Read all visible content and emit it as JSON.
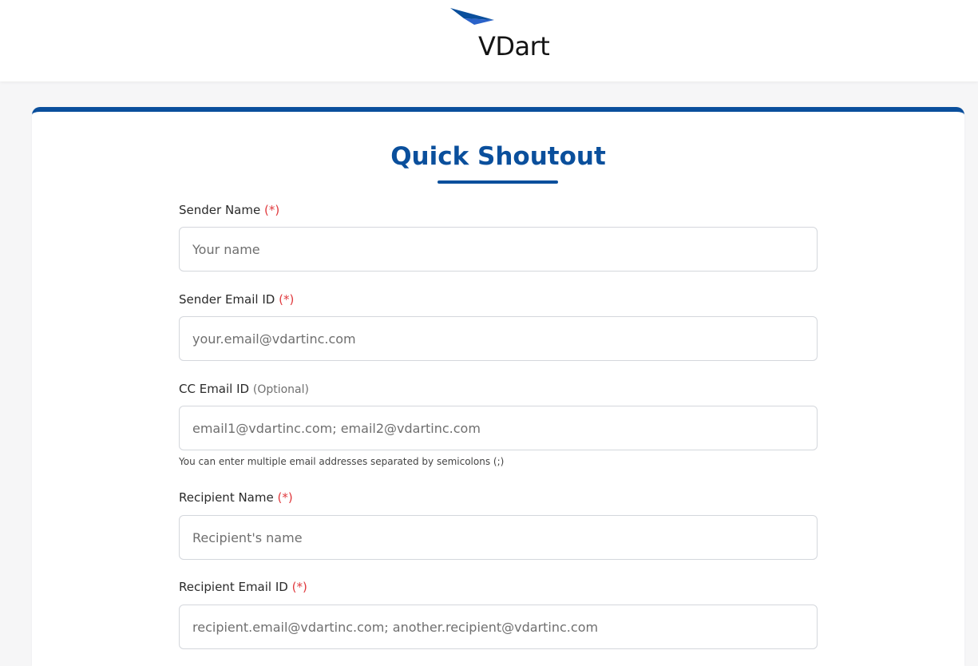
{
  "header": {
    "logo_text": "VDart",
    "brand_color": "#0a4f9c"
  },
  "form": {
    "title": "Quick Shoutout",
    "required_marker": "(*)",
    "fields": {
      "sender_name": {
        "label": "Sender Name",
        "placeholder": "Your name"
      },
      "sender_email": {
        "label": "Sender Email ID",
        "placeholder": "your.email@vdartinc.com"
      },
      "cc_email": {
        "label": "CC Email ID",
        "optional_marker": "(Optional)",
        "placeholder": "email1@vdartinc.com; email2@vdartinc.com",
        "help": "You can enter multiple email addresses separated by semicolons (;)"
      },
      "recipient_name": {
        "label": "Recipient Name",
        "placeholder": "Recipient's name"
      },
      "recipient_email": {
        "label": "Recipient Email ID",
        "placeholder": "recipient.email@vdartinc.com; another.recipient@vdartinc.com"
      }
    }
  },
  "colors": {
    "accent": "#0a4f9c",
    "required": "#e03a3e"
  }
}
